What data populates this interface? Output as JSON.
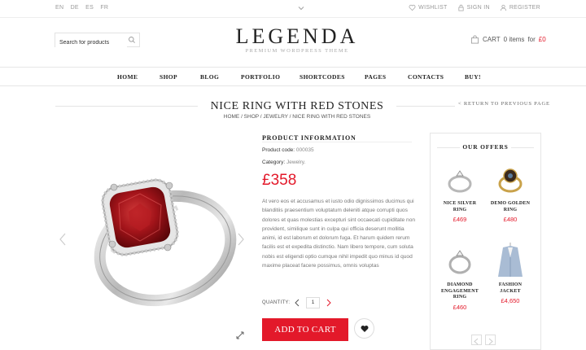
{
  "topbar": {
    "languages": [
      "EN",
      "DE",
      "ES",
      "FR"
    ],
    "links": [
      {
        "label": "WISHLIST",
        "icon": "heart-icon"
      },
      {
        "label": "SIGN IN",
        "icon": "lock-icon"
      },
      {
        "label": "REGISTER",
        "icon": "user-icon"
      }
    ]
  },
  "header": {
    "search_placeholder": "Search for products",
    "logo_name": "LEGENDA",
    "logo_tagline": "PREMIUM WORDPRESS THEME",
    "cart_label": "CART",
    "cart_items": "0 items",
    "cart_for": "for",
    "cart_total": "£0"
  },
  "nav": {
    "items": [
      "HOME",
      "SHOP",
      "BLOG",
      "PORTFOLIO",
      "SHORTCODES",
      "PAGES",
      "CONTACTS",
      "BUY!"
    ]
  },
  "page": {
    "title": "NICE RING WITH RED STONES",
    "breadcrumb": "HOME / SHOP / JEWELRY / NICE RING WITH RED STONES",
    "return_link": "< RETURN TO PREVIOUS PAGE"
  },
  "product": {
    "info_heading": "PRODUCT INFORMATION",
    "code_label": "Product code:",
    "code_value": "000035",
    "category_label": "Category:",
    "category_value": "Jewelry.",
    "price": "£358",
    "description": "At vero eos et accusamus et iusto odio dignissimos ducimus qui blanditiis praesentium voluptatum deleniti atque corrupti quos dolores et quas molestias excepturi sint occaecati cupiditate non provident, similique sunt in culpa qui officia deserunt mollitia animi, id est laborum et dolorum fuga. Et harum quidem rerum facilis est et expedita distinctio. Nam libero tempore, cum soluta nobis est eligendi optio cumque nihil impedit quo minus id quod maxime placeat facere possimus, omnis voluptas",
    "quantity_label": "QUANTITY:",
    "quantity_value": "1",
    "add_to_cart": "ADD TO CART"
  },
  "offers": {
    "title": "OUR OFFERS",
    "items": [
      {
        "name_lines": [
          "NICE SILVER",
          "RING"
        ],
        "price": "£469"
      },
      {
        "name_lines": [
          "DEMO GOLDEN",
          "RING"
        ],
        "price": "£480"
      },
      {
        "name_lines": [
          "DIAMOND",
          "ENGAGEMENT",
          "RING"
        ],
        "price": "£460"
      },
      {
        "name_lines": [
          "FASHION",
          "JACKET"
        ],
        "price": "£4,650"
      }
    ]
  },
  "colors": {
    "accent": "#e3192a",
    "text": "#222222",
    "muted": "#888888"
  }
}
